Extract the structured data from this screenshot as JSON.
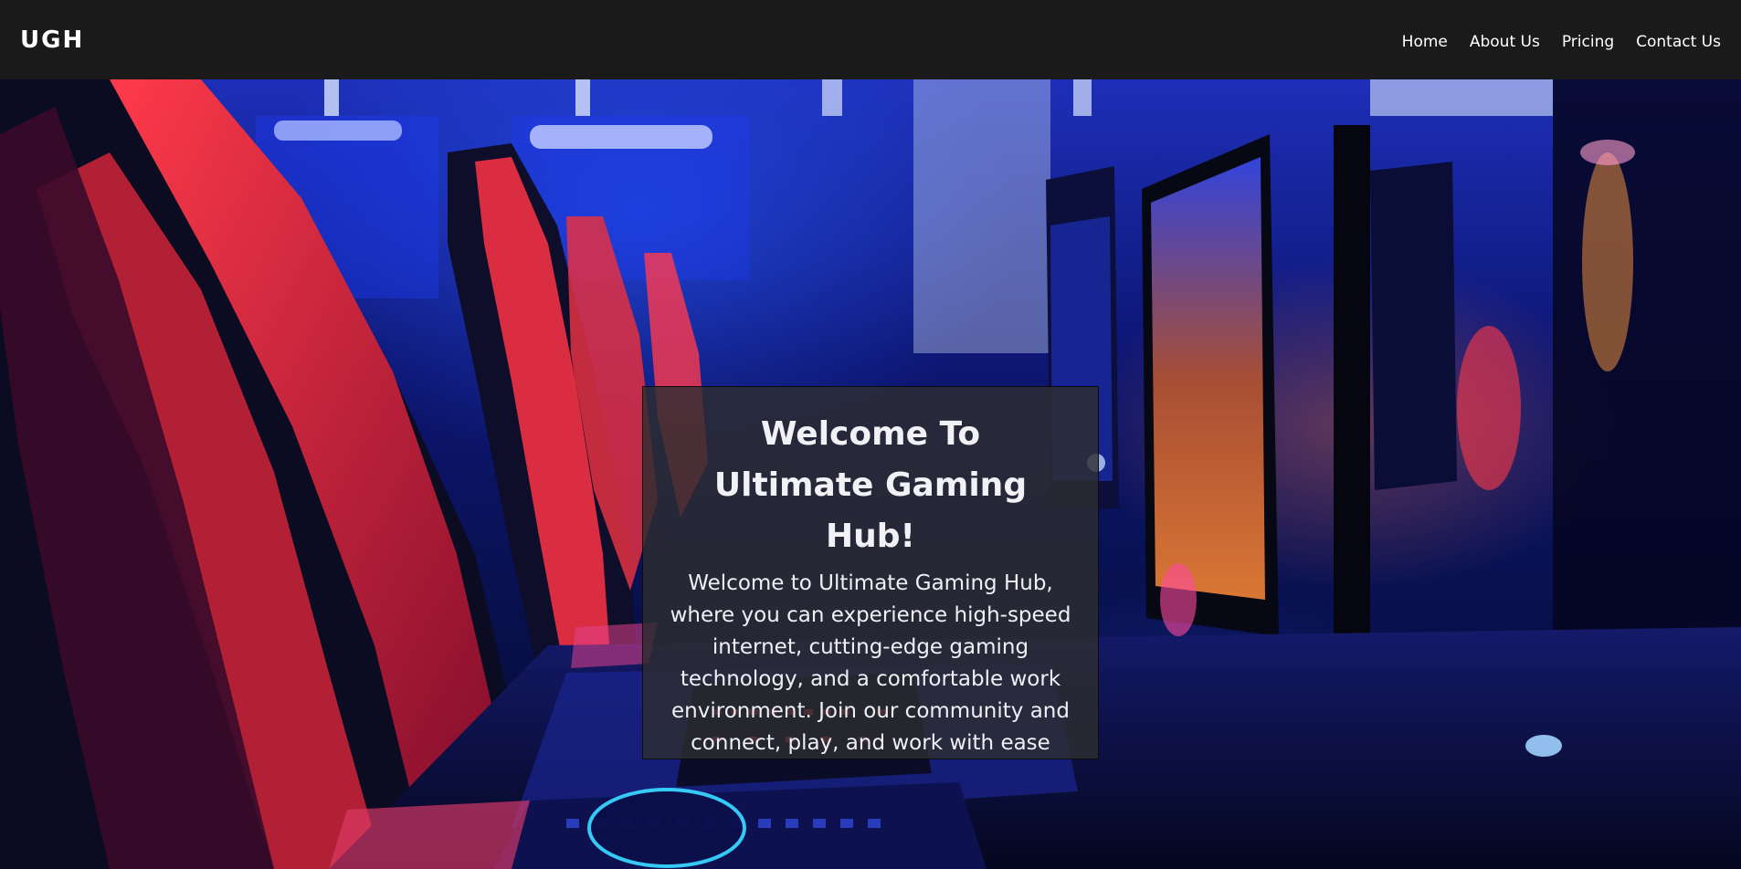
{
  "header": {
    "logo": "UGH",
    "nav": [
      {
        "label": "Home"
      },
      {
        "label": "About Us"
      },
      {
        "label": "Pricing"
      },
      {
        "label": "Contact Us"
      }
    ]
  },
  "hero": {
    "title": "Welcome To Ultimate Gaming Hub!",
    "text": "Welcome to Ultimate Gaming Hub, where you can experience high-speed internet, cutting-edge gaming technology, and a comfortable work environment. Join our community and connect, play, and work with ease"
  },
  "colors": {
    "header_bg": "#1a1a1a",
    "card_bg": "#2d2d30",
    "text": "#ffffff",
    "accent_red": "#e02a3c",
    "accent_blue": "#2040ff"
  }
}
